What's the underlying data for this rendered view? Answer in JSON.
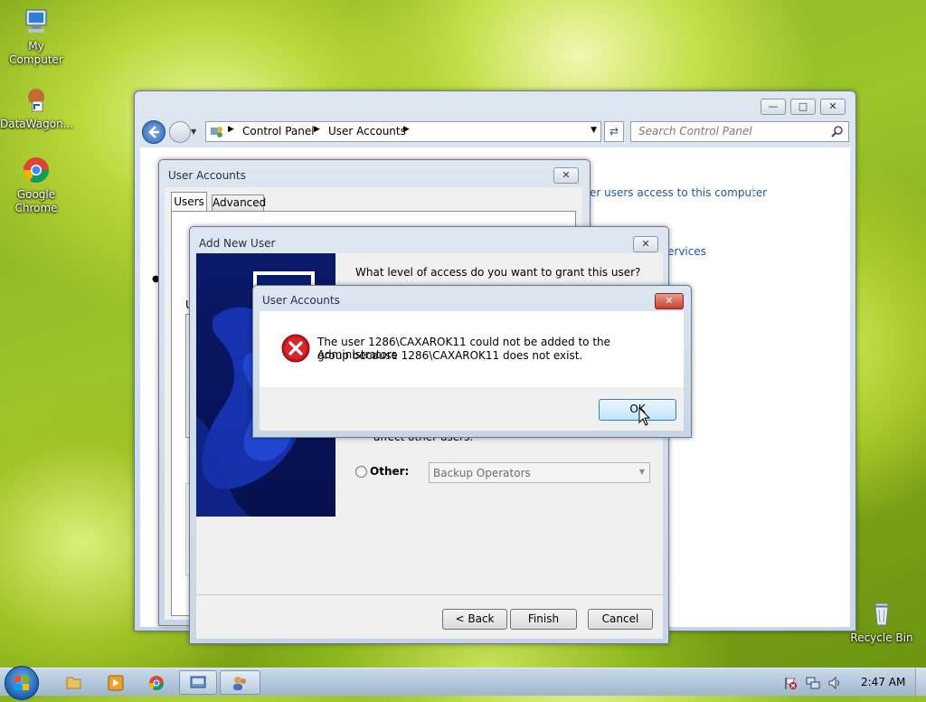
{
  "desktop": {
    "icons": [
      {
        "label": "My Computer"
      },
      {
        "label": "DataWagon..."
      },
      {
        "label": "Google Chrome"
      },
      {
        "label": "Recycle Bin"
      }
    ]
  },
  "explorer": {
    "breadcrumb": [
      "Control Panel",
      "User Accounts"
    ],
    "search_placeholder": "Search Control Panel",
    "links": [
      "er users access to this computer",
      "ervices"
    ]
  },
  "user_accounts_dialog": {
    "title": "User Accounts",
    "tabs": [
      "Users",
      "Advanced"
    ],
    "partial_label": "U"
  },
  "add_user_wizard": {
    "title": "Add New User",
    "question": "What level of access do you want to grant this user?",
    "partial_text": "affect other users.",
    "other_label": "Other:",
    "other_select_value": "Backup Operators",
    "back_label": "< Back",
    "finish_label": "Finish",
    "cancel_label": "Cancel"
  },
  "error_dialog": {
    "title": "User Accounts",
    "message_line1": "The user 1286\\CAXAROK11 could not be added to the Administrators",
    "message_line2": "group because 1286\\CAXAROK11 does not exist.",
    "ok_label": "OK"
  },
  "taskbar": {
    "clock": "2:47 AM"
  }
}
